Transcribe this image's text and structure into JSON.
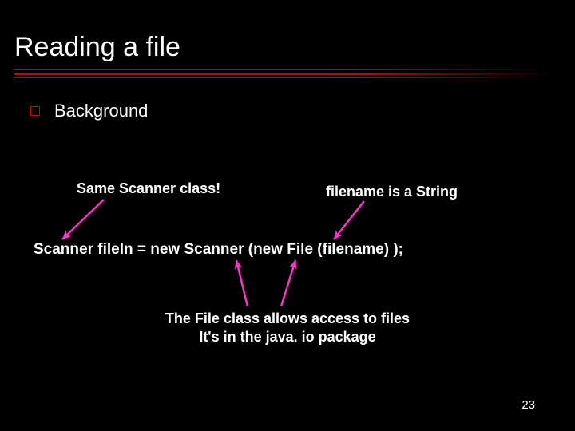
{
  "slide": {
    "title": "Reading a file",
    "bullet": {
      "label": "Background"
    },
    "callouts": {
      "left": "Same Scanner class!",
      "right": "filename is a String"
    },
    "code": "Scanner fileIn = new Scanner (new File (filename) );",
    "note_line1": "The File class allows access to files",
    "note_line2": "It's in the java. io package",
    "page_number": "23",
    "colors": {
      "accent": "#cc0000",
      "arrow": "#ff33cc"
    }
  }
}
